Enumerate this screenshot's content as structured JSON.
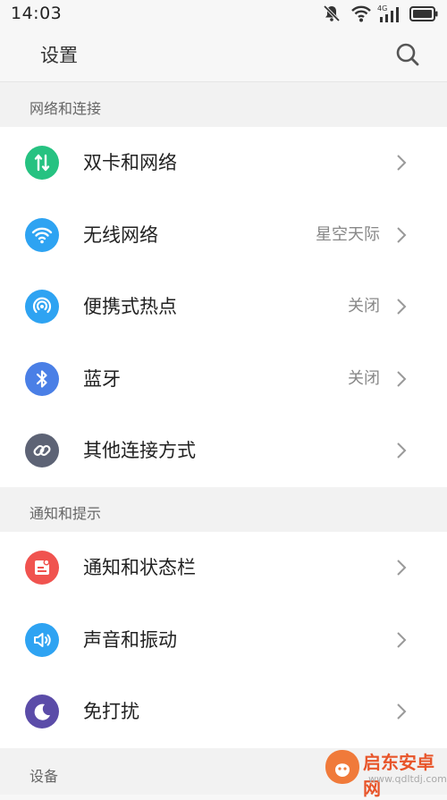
{
  "status_bar": {
    "time": "14:03",
    "icons": [
      "notifications-off-icon",
      "wifi-icon",
      "4g-signal-icon",
      "battery-icon"
    ],
    "network_label": "4G"
  },
  "header": {
    "title": "设置",
    "search_icon": "search-icon"
  },
  "sections": [
    {
      "title": "网络和连接",
      "items": [
        {
          "label": "双卡和网络",
          "value": "",
          "icon": "dual-sim-icon",
          "color": "#26c281"
        },
        {
          "label": "无线网络",
          "value": "星空天际",
          "icon": "wifi-icon",
          "color": "#2ea3f2"
        },
        {
          "label": "便携式热点",
          "value": "关闭",
          "icon": "hotspot-icon",
          "color": "#2ea3f2"
        },
        {
          "label": "蓝牙",
          "value": "关闭",
          "icon": "bluetooth-icon",
          "color": "#4a7fe6"
        },
        {
          "label": "其他连接方式",
          "value": "",
          "icon": "link-icon",
          "color": "#5d6375"
        }
      ]
    },
    {
      "title": "通知和提示",
      "items": [
        {
          "label": "通知和状态栏",
          "value": "",
          "icon": "notification-icon",
          "color": "#f0534f"
        },
        {
          "label": "声音和振动",
          "value": "",
          "icon": "sound-icon",
          "color": "#2ea3f2"
        },
        {
          "label": "免打扰",
          "value": "",
          "icon": "moon-icon",
          "color": "#5b4ca8"
        }
      ]
    },
    {
      "title": "设备",
      "items": []
    }
  ],
  "watermark": {
    "name": "启东安卓网",
    "url": "www.qdltdj.com"
  }
}
